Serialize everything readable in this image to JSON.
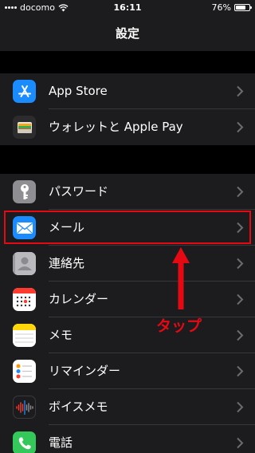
{
  "status_bar": {
    "carrier": "docomo",
    "time": "16:11",
    "battery_percent": "76%",
    "battery_level": 0.76
  },
  "nav": {
    "title": "設定"
  },
  "groups": [
    {
      "items": [
        {
          "label": "App Store",
          "icon": "app-store-icon",
          "color": "#1a8cff"
        },
        {
          "label": "ウォレットと Apple Pay",
          "icon": "wallet-icon",
          "color": "#1c1c1e"
        }
      ]
    },
    {
      "items": [
        {
          "label": "パスワード",
          "icon": "key-icon",
          "color": "#8e8e93"
        },
        {
          "label": "メール",
          "icon": "mail-icon",
          "color": "#1a8cff"
        },
        {
          "label": "連絡先",
          "icon": "contacts-icon",
          "color": "#a2a2a7"
        },
        {
          "label": "カレンダー",
          "icon": "calendar-icon",
          "color": "#ffffff"
        },
        {
          "label": "メモ",
          "icon": "notes-icon",
          "color": "#ffffff"
        },
        {
          "label": "リマインダー",
          "icon": "reminders-icon",
          "color": "#ffffff"
        },
        {
          "label": "ボイスメモ",
          "icon": "voice-memo-icon",
          "color": "#1c1c1e"
        },
        {
          "label": "電話",
          "icon": "phone-icon",
          "color": "#34c759"
        }
      ]
    }
  ],
  "annotation": {
    "text": "タップ",
    "color": "#e50914"
  }
}
